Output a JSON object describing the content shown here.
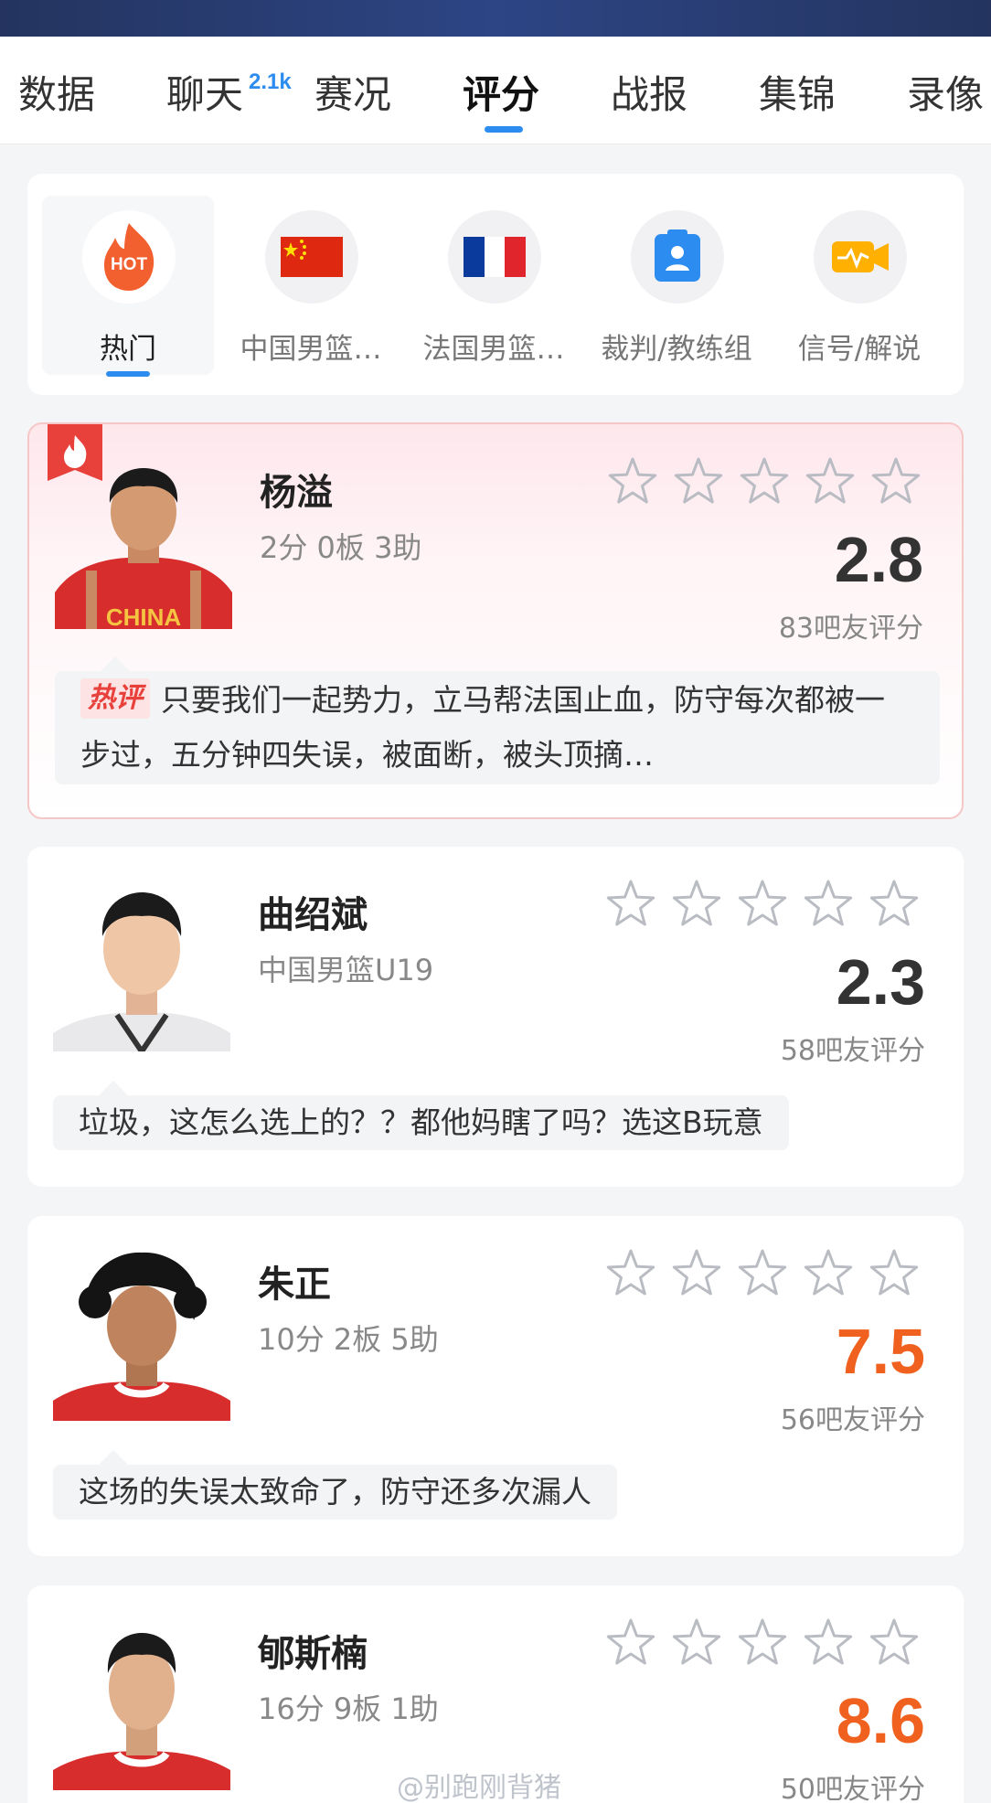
{
  "tabs": [
    {
      "label": "数据"
    },
    {
      "label": "聊天",
      "badge": "2.1k"
    },
    {
      "label": "赛况"
    },
    {
      "label": "评分",
      "active": true
    },
    {
      "label": "战报"
    },
    {
      "label": "集锦"
    },
    {
      "label": "录像"
    }
  ],
  "categories": [
    {
      "label": "热门",
      "icon": "hot-icon",
      "active": true
    },
    {
      "label": "中国男篮…",
      "icon": "china-flag-icon"
    },
    {
      "label": "法国男篮…",
      "icon": "france-flag-icon"
    },
    {
      "label": "裁判/教练组",
      "icon": "referee-icon"
    },
    {
      "label": "信号/解说",
      "icon": "broadcast-icon"
    }
  ],
  "hot_icon_text": "HOT",
  "players": [
    {
      "name": "杨溢",
      "stats": "2分 0板 3助",
      "score": "2.8",
      "votes": "83吧友评分",
      "hot": true,
      "hot_tag": "热评",
      "comment": "只要我们一起势力，立马帮法国止血，防守每次都被一步过，五分钟四失误，被面断，被头顶摘…",
      "jersey_text": "CHINA"
    },
    {
      "name": "曲绍斌",
      "stats": "中国男篮U19",
      "score": "2.3",
      "votes": "58吧友评分",
      "comment": "垃圾，这怎么选上的？？都他妈瞎了吗？选这B玩意"
    },
    {
      "name": "朱正",
      "stats": "10分 2板 5助",
      "score": "7.5",
      "votes": "56吧友评分",
      "comment": "这场的失误太致命了，防守还多次漏人"
    },
    {
      "name": "郇斯楠",
      "stats": "16分 9板 1助",
      "score": "8.6",
      "votes": "50吧友评分"
    }
  ],
  "colors": {
    "accent": "#2d8cf0",
    "high_score": "#f0611f",
    "hot_red": "#e8413c"
  },
  "watermark": "@别跑刚背猪"
}
